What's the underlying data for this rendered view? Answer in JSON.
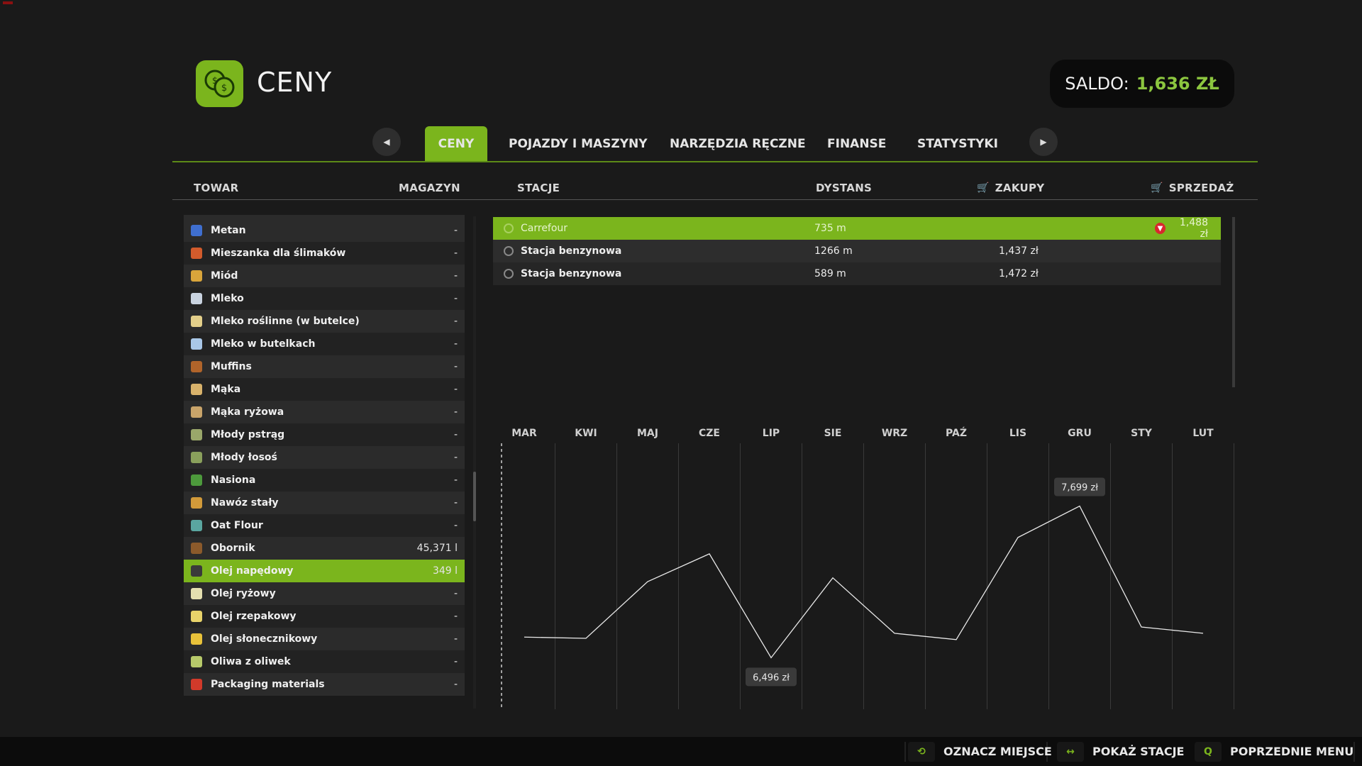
{
  "header": {
    "title": "CENY",
    "balance_label": "SALDO:",
    "balance_value": "1,636 ZŁ"
  },
  "tabs": [
    "CENY",
    "POJAZDY I MASZYNY",
    "NARZĘDZIA RĘCZNE",
    "FINANSE",
    "STATYSTYKI"
  ],
  "active_tab": "CENY",
  "columns": {
    "towar": "TOWAR",
    "magazyn": "MAGAZYN",
    "stacje": "STACJE",
    "dystans": "DYSTANS",
    "zakupy": "ZAKUPY",
    "sprzedaz": "SPRZEDAŻ"
  },
  "products": [
    {
      "name": "Metan",
      "stock": "-",
      "icon_color": "#3f6fd0"
    },
    {
      "name": "Mieszanka dla ślimaków",
      "stock": "-",
      "icon_color": "#d25b2c"
    },
    {
      "name": "Miód",
      "stock": "-",
      "icon_color": "#d9a53b"
    },
    {
      "name": "Mleko",
      "stock": "-",
      "icon_color": "#c9d3e0"
    },
    {
      "name": "Mleko roślinne (w butelce)",
      "stock": "-",
      "icon_color": "#e3cf8a"
    },
    {
      "name": "Mleko w butelkach",
      "stock": "-",
      "icon_color": "#a9c7e8"
    },
    {
      "name": "Muffins",
      "stock": "-",
      "icon_color": "#b0642a"
    },
    {
      "name": "Mąka",
      "stock": "-",
      "icon_color": "#d8b26b"
    },
    {
      "name": "Mąka ryżowa",
      "stock": "-",
      "icon_color": "#c9a46a"
    },
    {
      "name": "Młody pstrąg",
      "stock": "-",
      "icon_color": "#9aa76a"
    },
    {
      "name": "Młody łosoś",
      "stock": "-",
      "icon_color": "#8aa05c"
    },
    {
      "name": "Nasiona",
      "stock": "-",
      "icon_color": "#4d9a3c"
    },
    {
      "name": "Nawóz stały",
      "stock": "-",
      "icon_color": "#d29a3a"
    },
    {
      "name": "Oat Flour",
      "stock": "-",
      "icon_color": "#5aa6a0"
    },
    {
      "name": "Obornik",
      "stock": "45,371 l",
      "icon_color": "#8b5a2b"
    },
    {
      "name": "Olej napędowy",
      "stock": "349 l",
      "icon_color": "#3a3a3a",
      "selected": true
    },
    {
      "name": "Olej ryżowy",
      "stock": "-",
      "icon_color": "#e5e0b0"
    },
    {
      "name": "Olej rzepakowy",
      "stock": "-",
      "icon_color": "#e8d36a"
    },
    {
      "name": "Olej słonecznikowy",
      "stock": "-",
      "icon_color": "#e9c23a"
    },
    {
      "name": "Oliwa z oliwek",
      "stock": "-",
      "icon_color": "#b7c96a"
    },
    {
      "name": "Packaging materials",
      "stock": "-",
      "icon_color": "#d23a2a"
    }
  ],
  "stations": [
    {
      "name": "Carrefour",
      "distance": "735 m",
      "buy": "",
      "sell": "1,488 zł",
      "sell_trend": "down"
    },
    {
      "name": "Stacja benzynowa",
      "distance": "1266 m",
      "buy": "1,437 zł",
      "sell": ""
    },
    {
      "name": "Stacja benzynowa",
      "distance": "589 m",
      "buy": "1,472 zł",
      "sell": ""
    }
  ],
  "chart_data": {
    "type": "line",
    "categories": [
      "MAR",
      "KWI",
      "MAJ",
      "CZE",
      "LIP",
      "SIE",
      "WRZ",
      "PAŹ",
      "LIS",
      "GRU",
      "STY",
      "LUT"
    ],
    "values": [
      6.66,
      6.65,
      7.1,
      7.32,
      6.496,
      7.13,
      6.69,
      6.64,
      7.45,
      7.699,
      6.74,
      6.69
    ],
    "ylim": [
      6.2,
      8.0
    ],
    "annotations": [
      {
        "category": "GRU",
        "label": "7,699 zł"
      },
      {
        "category": "LIP",
        "label": "6,496 zł"
      }
    ],
    "line_color": "#e8e8e8"
  },
  "footer": [
    {
      "key_icon": "⟲",
      "label": "OZNACZ MIEJSCE"
    },
    {
      "key_icon": "↔",
      "label": "POKAŻ STACJE"
    },
    {
      "key_icon": "Q",
      "label": "POPRZEDNIE MENU"
    }
  ]
}
